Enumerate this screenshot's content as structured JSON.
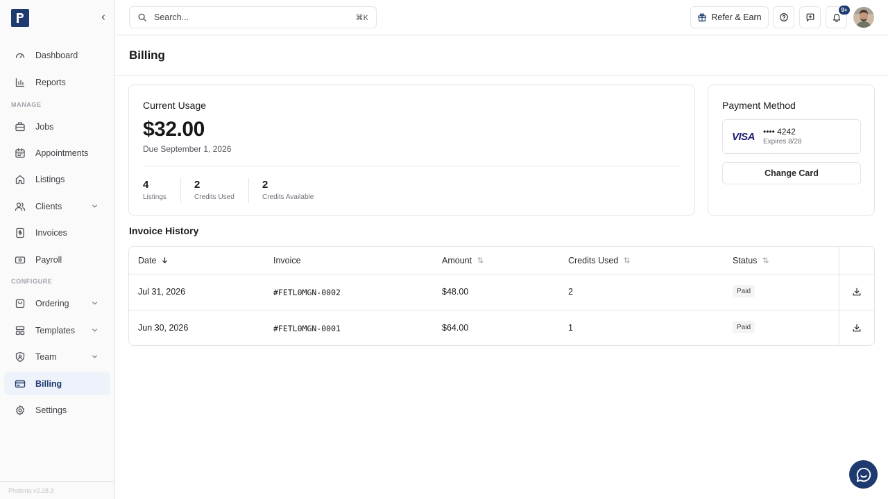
{
  "sidebar": {
    "items": [
      {
        "label": "Dashboard",
        "icon": "gauge-icon"
      },
      {
        "label": "Reports",
        "icon": "bar-chart-icon"
      },
      {
        "label": "Jobs",
        "icon": "briefcase-icon"
      },
      {
        "label": "Appointments",
        "icon": "calendar-icon"
      },
      {
        "label": "Listings",
        "icon": "home-icon"
      },
      {
        "label": "Clients",
        "icon": "users-icon"
      },
      {
        "label": "Invoices",
        "icon": "invoice-icon"
      },
      {
        "label": "Payroll",
        "icon": "banknote-icon"
      },
      {
        "label": "Ordering",
        "icon": "shopping-bag-icon"
      },
      {
        "label": "Templates",
        "icon": "layout-icon"
      },
      {
        "label": "Team",
        "icon": "shield-user-icon"
      },
      {
        "label": "Billing",
        "icon": "credit-card-icon"
      },
      {
        "label": "Settings",
        "icon": "gear-icon"
      }
    ],
    "sections": {
      "manage": "MANAGE",
      "configure": "CONFIGURE"
    },
    "version": "Photoria v2.28.3",
    "active": "Billing"
  },
  "topbar": {
    "search_placeholder": "Search...",
    "search_shortcut": "⌘K",
    "refer_label": "Refer & Earn",
    "notification_count": "9+"
  },
  "page": {
    "title": "Billing"
  },
  "usage": {
    "label": "Current Usage",
    "amount": "$32.00",
    "due": "Due September 1, 2026",
    "stats": [
      {
        "value": "4",
        "label": "Listings"
      },
      {
        "value": "2",
        "label": "Credits Used"
      },
      {
        "value": "2",
        "label": "Credits Available"
      }
    ]
  },
  "payment": {
    "label": "Payment Method",
    "brand": "VISA",
    "number": "•••• 4242",
    "expires": "Expires 8/28",
    "change_label": "Change Card"
  },
  "invoices": {
    "title": "Invoice History",
    "columns": {
      "date": "Date",
      "invoice": "Invoice",
      "amount": "Amount",
      "credits": "Credits Used",
      "status": "Status"
    },
    "rows": [
      {
        "date": "Jul 31, 2026",
        "invoice": "#FETL0MGN-0002",
        "amount": "$48.00",
        "credits": "2",
        "status": "Paid"
      },
      {
        "date": "Jun 30, 2026",
        "invoice": "#FETL0MGN-0001",
        "amount": "$64.00",
        "credits": "1",
        "status": "Paid"
      }
    ]
  },
  "colors": {
    "brand": "#1e3a6e",
    "active_bg": "#eef2fa",
    "border": "#e4e4e7"
  }
}
